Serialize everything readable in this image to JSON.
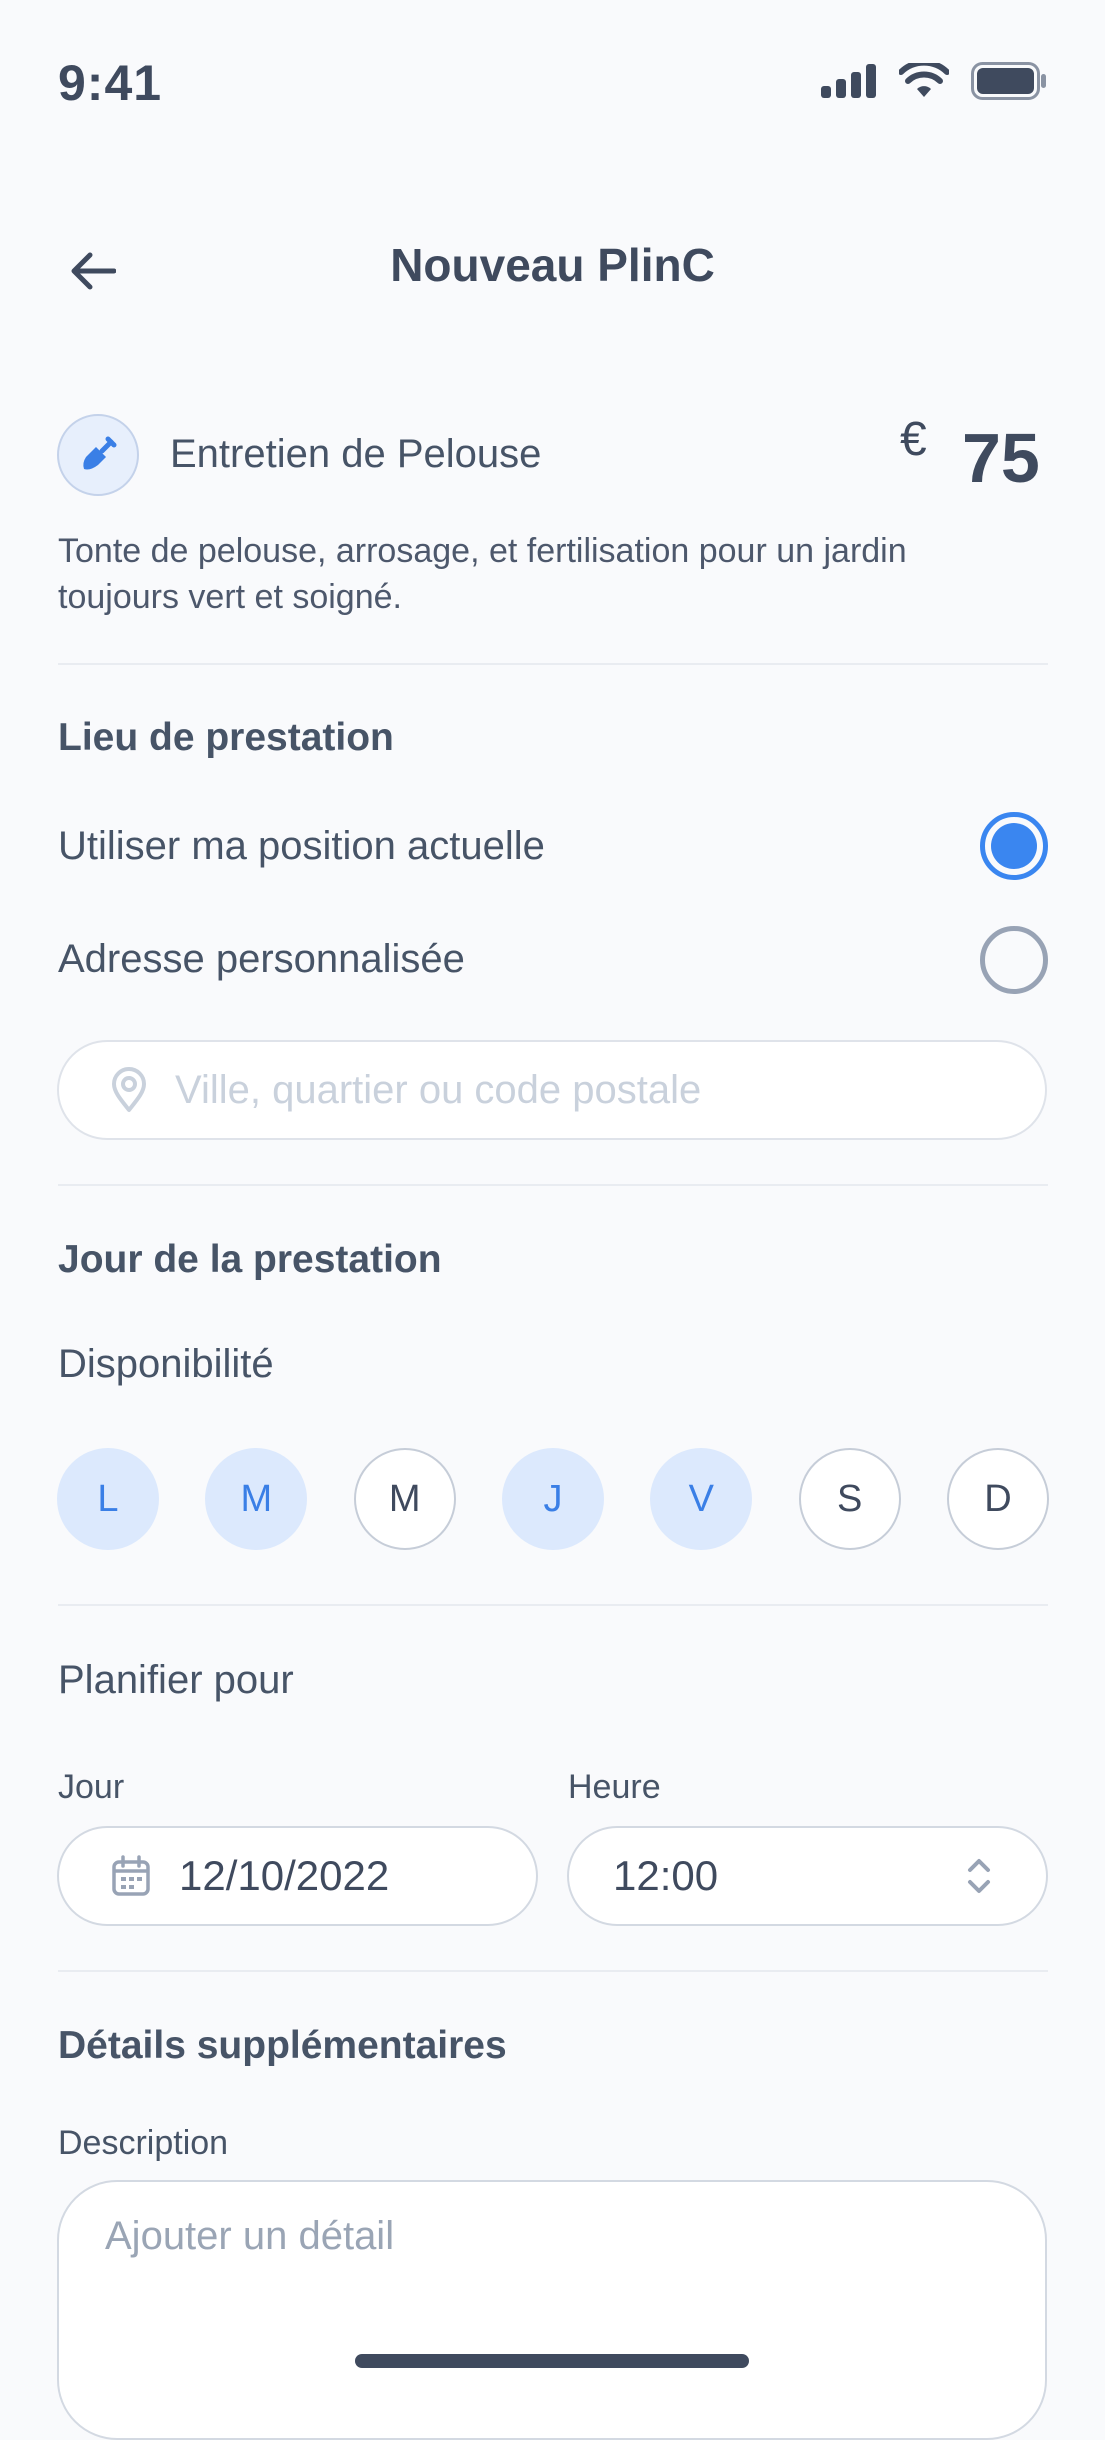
{
  "status_bar": {
    "time": "9:41"
  },
  "header": {
    "title": "Nouveau PlinC",
    "back_icon": "arrow-left-icon"
  },
  "service": {
    "icon": "shovel-icon",
    "name": "Entretien de Pelouse",
    "currency": "€",
    "price": "75",
    "description": "Tonte de pelouse, arrosage, et fertilisation pour un jardin toujours vert et soigné."
  },
  "location": {
    "title": "Lieu de prestation",
    "options": [
      {
        "label": "Utiliser ma position actuelle",
        "selected": true
      },
      {
        "label": "Adresse personnalisée",
        "selected": false
      }
    ],
    "input_placeholder": "Ville, quartier ou code postale",
    "input_value": ""
  },
  "day": {
    "title": "Jour de la prestation",
    "availability_label": "Disponibilité",
    "days": [
      {
        "label": "L",
        "selected": true
      },
      {
        "label": "M",
        "selected": true
      },
      {
        "label": "M",
        "selected": false
      },
      {
        "label": "J",
        "selected": true
      },
      {
        "label": "V",
        "selected": true
      },
      {
        "label": "S",
        "selected": false
      },
      {
        "label": "D",
        "selected": false
      }
    ]
  },
  "schedule": {
    "title": "Planifier pour",
    "day_label": "Jour",
    "day_value": "12/10/2022",
    "hour_label": "Heure",
    "hour_value": "12:00"
  },
  "details": {
    "title": "Détails supplémentaires",
    "description_label": "Description",
    "description_placeholder": "Ajouter un détail",
    "description_value": ""
  },
  "colors": {
    "accent": "#3a86f0",
    "selected_day_bg": "#dce9fd",
    "text": "#475467"
  }
}
